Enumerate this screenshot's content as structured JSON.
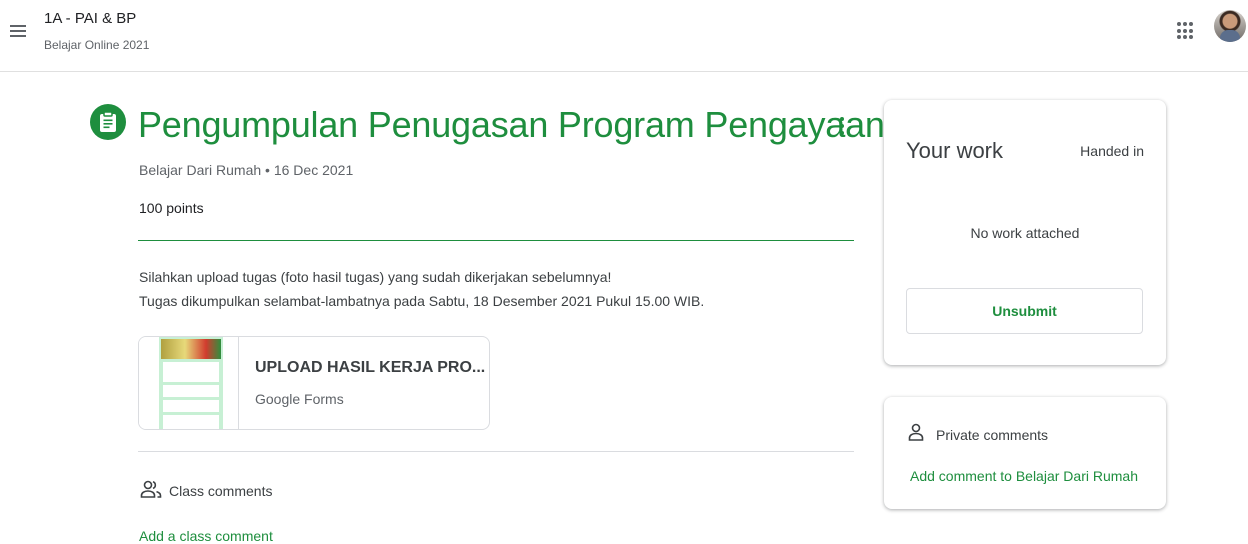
{
  "header": {
    "class_name": "1A - PAI & BP",
    "class_section": "Belajar Online 2021"
  },
  "assignment": {
    "title": "Pengumpulan Penugasan Program Pengayaan",
    "meta": "Belajar Dari Rumah • 16 Dec 2021",
    "points": "100 points",
    "description_line1": "Silahkan upload tugas (foto hasil tugas) yang sudah dikerjakan sebelumnya!",
    "description_line2": "Tugas dikumpulkan selambat-lambatnya pada Sabtu, 18 Desember 2021 Pukul 15.00 WIB.",
    "attachment": {
      "title": "UPLOAD HASIL KERJA PRO...",
      "type": "Google Forms"
    }
  },
  "class_comments": {
    "label": "Class comments",
    "add_label": "Add a class comment"
  },
  "your_work": {
    "title": "Your work",
    "status": "Handed in",
    "empty_text": "No work attached",
    "unsubmit_label": "Unsubmit"
  },
  "private_comments": {
    "label": "Private comments",
    "add_label": "Add comment to Belajar Dari Rumah"
  },
  "colors": {
    "accent": "#1e8e3e",
    "text": "#3c4043",
    "muted": "#5f6368"
  },
  "icons": [
    "menu-icon",
    "apps-grid-icon",
    "avatar",
    "assignment-icon",
    "more-vert-icon",
    "class-comments-icon",
    "person-icon"
  ]
}
